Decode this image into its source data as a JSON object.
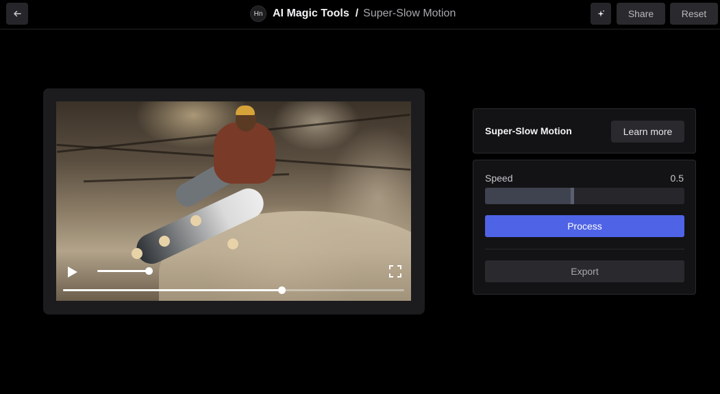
{
  "header": {
    "back_icon": "arrow-left-icon",
    "avatar_initials": "Hn",
    "app_title": "AI Magic Tools",
    "separator": "/",
    "page_name": "Super-Slow Motion",
    "sparkle_icon": "sparkle-icon",
    "share_label": "Share",
    "reset_label": "Reset"
  },
  "player": {
    "play_icon": "play-icon",
    "fullscreen_icon": "fullscreen-icon",
    "volume_level": 1.0,
    "progress": 0.64
  },
  "panel": {
    "title": "Super-Slow Motion",
    "learn_more_label": "Learn more",
    "speed_label": "Speed",
    "speed_value": "0.5",
    "speed_fraction": 0.44,
    "process_label": "Process",
    "export_label": "Export"
  },
  "colors": {
    "accent": "#4f63e6",
    "background": "#000000",
    "card": "#131315"
  }
}
